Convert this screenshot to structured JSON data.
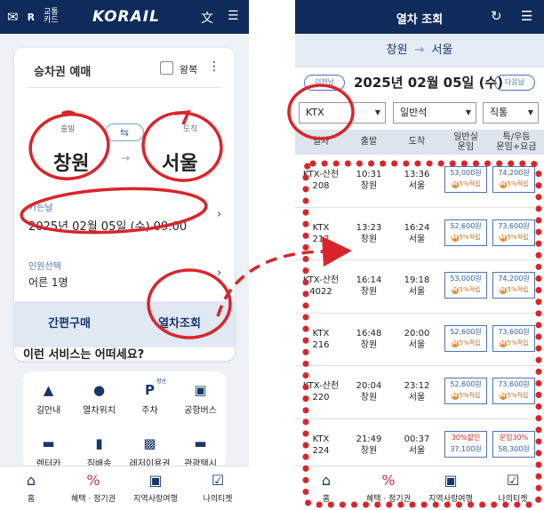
{
  "left": {
    "header": {
      "logo": "KORAIL",
      "badge_label": "교통\n카드"
    },
    "card": {
      "title": "승차권 예매",
      "round_trip_label": "왕복",
      "dep_label": "출발",
      "arr_label": "도착",
      "departure": "창원",
      "arrival": "서울",
      "date_label": "가는날",
      "date_value": "2025년 02월 05일 (수) 09:00",
      "pax_label": "인원선택",
      "pax_value": "어른 1명",
      "btn_quick": "간편구매",
      "btn_search": "열차조회"
    },
    "services": {
      "title": "이런 서비스는 어떠세요?",
      "items": [
        {
          "label": "길안내",
          "icon": "navigation-icon"
        },
        {
          "label": "열차위치",
          "icon": "location-pin-icon"
        },
        {
          "label": "주차",
          "icon": "parking-icon",
          "tag": "정산"
        },
        {
          "label": "공항버스",
          "icon": "bus-icon"
        },
        {
          "label": "렌터카",
          "icon": "car-icon"
        },
        {
          "label": "짐배송",
          "icon": "luggage-icon"
        },
        {
          "label": "레저이용권",
          "icon": "ticket-icon"
        },
        {
          "label": "관광택시",
          "icon": "taxi-icon"
        }
      ]
    },
    "nav": [
      {
        "label": "홈",
        "icon": "home-icon"
      },
      {
        "label": "혜택 · 정기권",
        "icon": "discount-icon"
      },
      {
        "label": "지역사랑여행",
        "icon": "bag-icon"
      },
      {
        "label": "나의티켓",
        "icon": "ticket-check-icon"
      }
    ]
  },
  "right": {
    "header": {
      "title": "열차 조회"
    },
    "route": {
      "from": "창원",
      "arrow": "→",
      "to": "서울"
    },
    "date": {
      "prev": "이전날",
      "value": "2025년 02월 05일 (수)",
      "next": "다음날"
    },
    "filters": {
      "train_type": "KTX",
      "seat_class": "일반석",
      "direct": "직통"
    },
    "columns": [
      "열차",
      "출발",
      "도착",
      "일반실\n운임",
      "특/우등\n운임+요금"
    ],
    "trains": [
      {
        "name": "KTX-산천",
        "no": "208",
        "dep_time": "10:31",
        "dep_st": "창원",
        "arr_time": "13:36",
        "arr_st": "서울",
        "general": "53,000원",
        "general_pt": "5%적립",
        "special": "74,200원",
        "special_pt": "5%적립"
      },
      {
        "name": "KTX",
        "no": "212",
        "dep_time": "13:23",
        "dep_st": "창원",
        "arr_time": "16:24",
        "arr_st": "서울",
        "general": "52,600원",
        "general_pt": "5%적립",
        "special": "73,600원",
        "special_pt": "5%적립"
      },
      {
        "name": "KTX-산천",
        "no": "4022",
        "dep_time": "16:14",
        "dep_st": "창원",
        "arr_time": "19:18",
        "arr_st": "서울",
        "general": "53,000원",
        "general_pt": "5%적립",
        "special": "74,200원",
        "special_pt": "5%적립"
      },
      {
        "name": "KTX",
        "no": "216",
        "dep_time": "16:48",
        "dep_st": "창원",
        "arr_time": "20:00",
        "arr_st": "서울",
        "general": "52,600원",
        "general_pt": "5%적립",
        "special": "73,600원",
        "special_pt": "5%적립"
      },
      {
        "name": "KTX-산천",
        "no": "220",
        "dep_time": "20:04",
        "dep_st": "창원",
        "arr_time": "23:12",
        "arr_st": "서울",
        "general": "52,600원",
        "general_pt": "5%적립",
        "special": "73,600원",
        "special_pt": "5%적립"
      },
      {
        "name": "KTX",
        "no": "224",
        "dep_time": "21:49",
        "dep_st": "창원",
        "arr_time": "00:37",
        "arr_st": "서울",
        "general_discount": "30%할인",
        "general": "37,100원",
        "special_discount": "운임30%",
        "special": "58,300원"
      }
    ],
    "nav": [
      {
        "label": "홈",
        "icon": "home-icon"
      },
      {
        "label": "혜택 · 정기권",
        "icon": "discount-icon"
      },
      {
        "label": "지역사랑여행",
        "icon": "bag-icon"
      },
      {
        "label": "나의티켓",
        "icon": "ticket-check-icon"
      }
    ]
  },
  "colors": {
    "navy": "#0f2b5b",
    "light_blue": "#e4ecf6",
    "annotation_red": "#d9252a",
    "fare_blue": "#2f5fa3"
  }
}
